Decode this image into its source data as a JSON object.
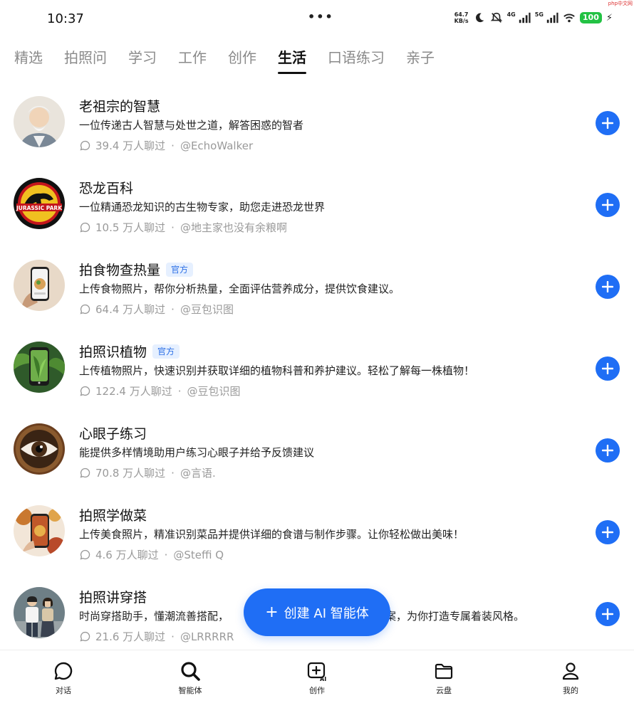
{
  "status_bar": {
    "time": "10:37",
    "dots": "•••",
    "net_speed_value": "64.7",
    "net_speed_unit": "KB/s",
    "signal_1": "4G",
    "signal_2": "5G",
    "battery": "100",
    "brand": "php中文网"
  },
  "tabs": [
    {
      "label": "精选",
      "active": false
    },
    {
      "label": "拍照问",
      "active": false
    },
    {
      "label": "学习",
      "active": false
    },
    {
      "label": "工作",
      "active": false
    },
    {
      "label": "创作",
      "active": false
    },
    {
      "label": "生活",
      "active": true
    },
    {
      "label": "口语练习",
      "active": false
    },
    {
      "label": "亲子",
      "active": false
    }
  ],
  "agents": [
    {
      "title": "老祖宗的智慧",
      "badge": "",
      "desc": "一位传递古人智慧与处世之道，解答困惑的智者",
      "count": "39.4 万人聊过",
      "author": "@EchoWalker",
      "avatar_icon": "sage-avatar"
    },
    {
      "title": "恐龙百科",
      "badge": "",
      "desc": "一位精通恐龙知识的古生物专家，助您走进恐龙世界",
      "count": "10.5 万人聊过",
      "author": "@地主家也没有余粮啊",
      "avatar_icon": "jurassic-park-avatar",
      "avatar_text": "JURASSIC PARK"
    },
    {
      "title": "拍食物查热量",
      "badge": "官方",
      "desc": "上传食物照片，帮你分析热量，全面评估营养成分，提供饮食建议。",
      "count": "64.4 万人聊过",
      "author": "@豆包识图",
      "avatar_icon": "phone-food-avatar"
    },
    {
      "title": "拍照识植物",
      "badge": "官方",
      "desc": "上传植物照片，快速识别并获取详细的植物科普和养护建议。轻松了解每一株植物！",
      "count": "122.4 万人聊过",
      "author": "@豆包识图",
      "avatar_icon": "phone-plant-avatar"
    },
    {
      "title": "心眼子练习",
      "badge": "",
      "desc": "能提供多样情境助用户练习心眼子并给予反馈建议",
      "count": "70.8 万人聊过",
      "author": "@言语.",
      "avatar_icon": "eye-avatar"
    },
    {
      "title": "拍照学做菜",
      "badge": "",
      "desc": "上传美食照片，精准识别菜品并提供详细的食谱与制作步骤。让你轻松做出美味！",
      "count": "4.6 万人聊过",
      "author": "@Steffi Q",
      "avatar_icon": "phone-dish-avatar"
    },
    {
      "title": "拍照讲穿搭",
      "badge": "",
      "desc": "时尚穿搭助手，懂潮流善搭配，",
      "desc_tail": "搭方案，为你打造专属着装风格。",
      "count": "21.6 万人聊过",
      "author": "@LRRRRR",
      "avatar_icon": "couple-avatar"
    }
  ],
  "fab": {
    "label": "创建 AI 智能体",
    "plus": "+"
  },
  "bottom_nav": [
    {
      "label": "对话",
      "icon": "chat-bubble-icon"
    },
    {
      "label": "智能体",
      "icon": "search-icon"
    },
    {
      "label": "创作",
      "icon": "create-ai-icon",
      "icon_text": "AI"
    },
    {
      "label": "云盘",
      "icon": "folder-icon"
    },
    {
      "label": "我的",
      "icon": "person-icon"
    }
  ],
  "colors": {
    "accent": "#1f6ef5",
    "badge_bg": "#e6f0ff",
    "badge_text": "#2c6fe6",
    "battery": "#23c244"
  }
}
